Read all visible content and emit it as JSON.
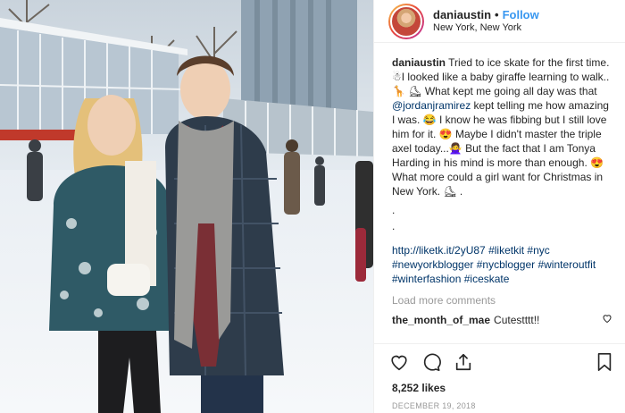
{
  "post": {
    "username": "daniaustin",
    "follow_label": "Follow",
    "separator": "•",
    "location": "New York, New York"
  },
  "caption": {
    "username": "daniaustin",
    "text_1": "Tried to ice skate for the first time. ☃I looked like a baby giraffe learning to walk..🦒 ⛸ What kept me going all day was that ",
    "mention": "@jordanjramirez",
    "text_2": " kept telling me how amazing I was. 😂 I know he was fibbing but I still love him for it. 😍 Maybe I didn't master the triple axel today...🙅‍♀️ But the fact that I am Tonya Harding in his mind is more than enough. 😍What more could a girl want for Christmas in New York. ⛸ .",
    "dots": [
      ".",
      "."
    ],
    "link": "http://liketk.it/2yU87",
    "hashtags": [
      "#liketkit",
      "#nyc",
      "#newyorkblogger",
      "#nycblogger",
      "#winteroutfit",
      "#winterfashion",
      "#iceskate"
    ]
  },
  "load_more_label": "Load more comments",
  "comments": [
    {
      "username": "the_month_of_mae",
      "text": "Cutestttt!!"
    }
  ],
  "likes": "8,252 likes",
  "date": "DECEMBER 19, 2018",
  "icons": {
    "like": "heart-icon",
    "comment": "comment-icon",
    "share": "share-icon",
    "save": "bookmark-icon"
  },
  "colors": {
    "link_blue": "#3897f0",
    "hashtag": "#003569",
    "muted": "#999999"
  }
}
